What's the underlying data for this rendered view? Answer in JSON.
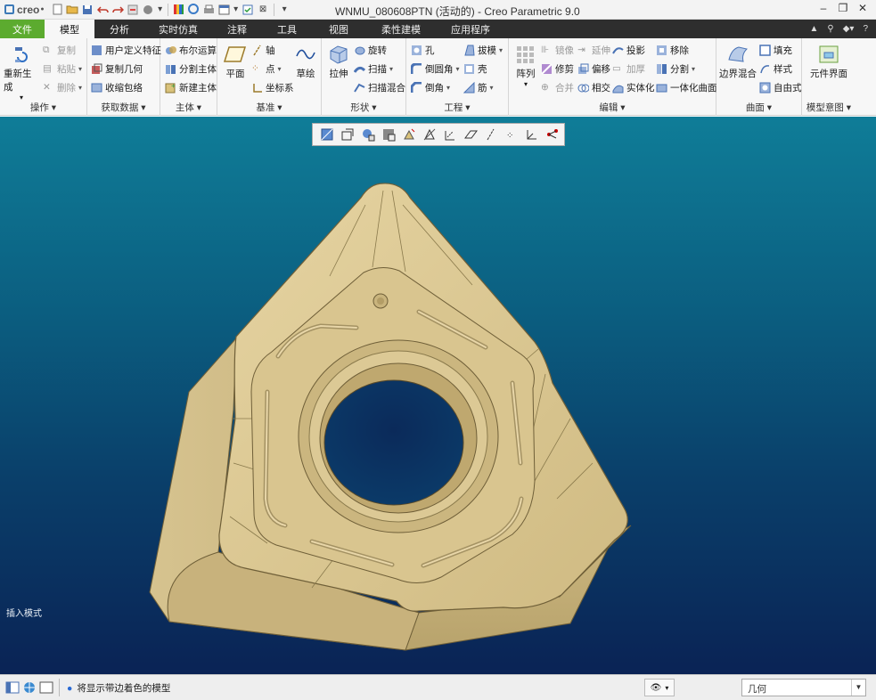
{
  "app": {
    "logo_text": "creo",
    "window_title": "WNMU_080608PTN (活动的) - Creo Parametric 9.0"
  },
  "tabs": [
    "文件",
    "模型",
    "分析",
    "实时仿真",
    "注释",
    "工具",
    "视图",
    "柔性建模",
    "应用程序"
  ],
  "ribbon": {
    "operations": {
      "regenerate": "重新生成",
      "copy": "复制",
      "paste": "粘贴",
      "delete": "删除",
      "label": "操作"
    },
    "get_data": {
      "udf": "用户定义特征",
      "copy_geom": "复制几何",
      "shrinkwrap": "收缩包络",
      "label": "获取数据"
    },
    "body": {
      "boolean": "布尔运算",
      "split_body": "分割主体",
      "new_body": "新建主体",
      "label": "主体"
    },
    "datum": {
      "plane": "平面",
      "axis": "轴",
      "point": "点",
      "csys": "坐标系",
      "sketch": "草绘",
      "label": "基准"
    },
    "shapes": {
      "extrude": "拉伸",
      "revolve": "旋转",
      "sweep": "扫描",
      "swept_blend": "扫描混合",
      "label": "形状"
    },
    "engineering": {
      "hole": "孔",
      "round": "倒圆角",
      "chamfer": "倒角",
      "draft": "拔模",
      "shell": "壳",
      "rib": "筋",
      "label": "工程"
    },
    "editing": {
      "pattern": "阵列",
      "mirror": "镜像",
      "trim": "修剪",
      "merge": "合并",
      "extend": "延伸",
      "offset": "偏移",
      "intersect": "相交",
      "project": "投影",
      "thicken": "加厚",
      "solidify": "实体化",
      "remove": "移除",
      "split": "分割",
      "unify": "一体化曲面",
      "label": "编辑"
    },
    "surfaces": {
      "boundary_blend": "边界混合",
      "fill": "填充",
      "style": "样式",
      "freestyle": "自由式",
      "label": "曲面"
    },
    "model_intent": {
      "component_interface": "元件界面",
      "label": "模型意图"
    }
  },
  "viewport": {
    "mode_label": "插入模式"
  },
  "status": {
    "message": "将显示带边着色的模型",
    "filter_value": "几何"
  },
  "colors": {
    "file_tab": "#5cab2f",
    "tab_bar": "#2e2e2e",
    "model": "#d8c48e",
    "viewport_top": "#0f7d98",
    "viewport_bottom": "#0a2355"
  }
}
